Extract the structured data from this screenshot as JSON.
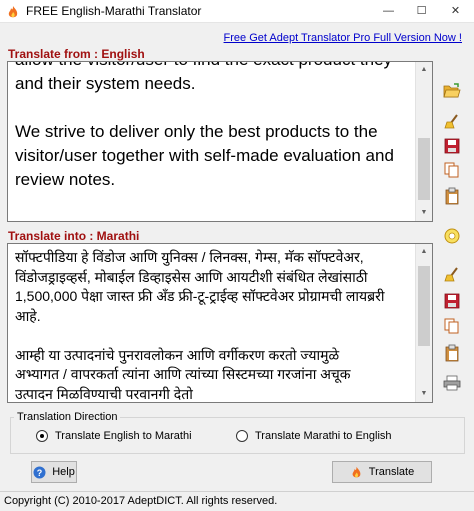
{
  "window": {
    "title": "FREE English-Marathi Translator",
    "minimize_glyph": "—",
    "maximize_glyph": "☐",
    "close_glyph": "✕"
  },
  "promo_link": "Free Get Adept Translator Pro Full Version Now !",
  "translate_from": {
    "label": "Translate from : English",
    "text": "allow the visitor/user to find the exact product they\nand their system needs.\n\nWe strive to deliver only the best products to the\nvisitor/user together with self-made evaluation and\nreview notes.\n\nThis is a Softpedia test"
  },
  "translate_into": {
    "label": "Translate into : Marathi",
    "text": "सॉफ्टपीडिया हे विंडोज आणि युनिक्स / लिनक्स, गेम्स, मॅक सॉफ्टवेअर,\nविंडोजड्राइव्हर्स, मोबाईल डिव्हाइसेस आणि आयटीशी संबंधित लेखांसाठी\n1,500,000 पेक्षा जास्त फ्री अँड फ्री-टू-ट्राईव्ह सॉफ्टवेअर प्रोग्रामची लायब्ररी\nआहे.\n\nआम्ही या उत्पादनांचे पुनरावलोकन आणि वर्गीकरण करतो ज्यामुळे\nअभ्यागत / वापरकर्ता त्यांना आणि त्यांच्या सिस्टमच्या गरजांना अचूक\nउत्पादन मिळविण्याची परवानगी देतो"
  },
  "direction": {
    "group_label": "Translation Direction",
    "option_en_mr": "Translate English to Marathi",
    "option_mr_en": "Translate Marathi to English",
    "selected": "option_en_mr"
  },
  "buttons": {
    "help_label": "Help",
    "translate_label": "Translate"
  },
  "status": {
    "copyright": "Copyright (C) 2010-2017 AdeptDICT. All rights reserved."
  },
  "icons": {
    "app": "flame-icon",
    "open": "open-folder-icon",
    "clear": "broom-icon",
    "save": "save-disk-icon",
    "copy": "copy-icon",
    "paste": "paste-clipboard-icon",
    "print": "printer-icon"
  },
  "colors": {
    "section_label": "#a01010",
    "link": "#0000cc"
  }
}
